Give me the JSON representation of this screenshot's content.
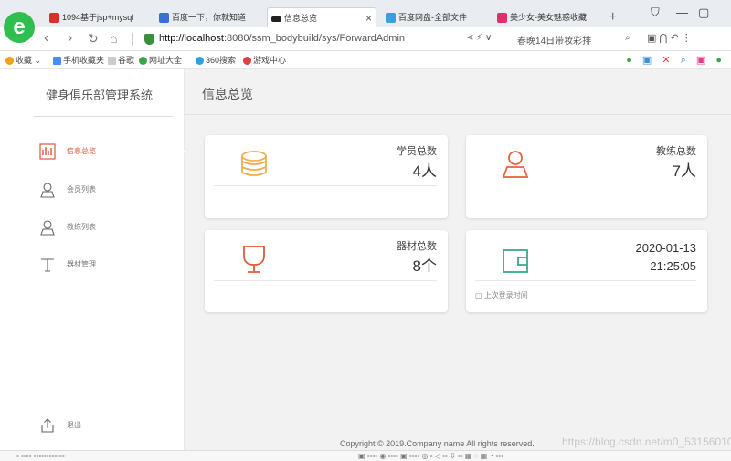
{
  "browser": {
    "tabs": [
      {
        "label": "1094基于jsp+mysql",
        "active": false
      },
      {
        "label": "百度一下，你就知道",
        "active": false
      },
      {
        "label": "信息总览",
        "active": true
      },
      {
        "label": "百度网盘-全部文件",
        "active": false
      },
      {
        "label": "美少女-美女魅惑收藏",
        "active": false
      }
    ],
    "new_tab": "+",
    "url_host": "http://localhost",
    "url_path": ":8080/ssm_bodybuild/sys/ForwardAdmin",
    "news_ticker": "春晚14日带妆彩排",
    "favorites": [
      {
        "label": "收藏",
        "color": "#f2a11b"
      },
      {
        "label": "手机收藏夹",
        "color": "#4c8bf5"
      },
      {
        "label": "谷歌",
        "color": "#cccccc"
      },
      {
        "label": "网址大全",
        "color": "#3aa649"
      },
      {
        "label": "360搜索",
        "color": "#2ea0e0"
      },
      {
        "label": "游戏中心",
        "color": "#e04040"
      }
    ]
  },
  "sidebar": {
    "title": "健身俱乐部管理系统",
    "items": [
      {
        "label": "信息总览",
        "icon": "chart-icon",
        "active": true
      },
      {
        "label": "会员列表",
        "icon": "user-icon",
        "active": false
      },
      {
        "label": "教练列表",
        "icon": "user-icon",
        "active": false
      },
      {
        "label": "器材管理",
        "icon": "text-icon",
        "active": false
      }
    ],
    "logout_label": "退出"
  },
  "main": {
    "title": "信息总览",
    "cards": [
      {
        "label": "学员总数",
        "value": "4人",
        "icon": "database-icon",
        "icon_color": "#f0ad4e"
      },
      {
        "label": "教练总数",
        "value": "7人",
        "icon": "user-icon",
        "icon_color": "#e8603c"
      },
      {
        "label": "器材总数",
        "value": "8个",
        "icon": "trophy-icon",
        "icon_color": "#e05a3a"
      }
    ],
    "last_login": {
      "date": "2020-01-13",
      "time": "21:25:05",
      "label": "上次登录时间",
      "icon": "wallet-icon",
      "icon_color": "#3aa88a"
    },
    "footer": "Copyright © 2019.Company name All rights reserved.",
    "watermark": "https://blog.csdn.net/m0_53156010"
  }
}
